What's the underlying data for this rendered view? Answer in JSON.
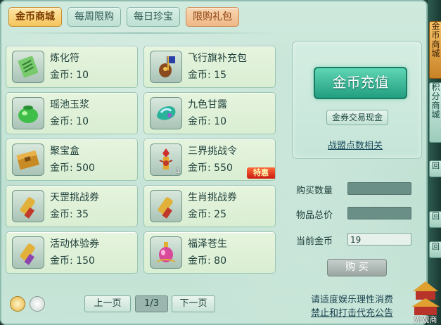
{
  "tabs": [
    {
      "label": "金币商城",
      "active": true
    },
    {
      "label": "每周限购",
      "active": false
    },
    {
      "label": "每日珍宝",
      "active": false
    },
    {
      "label": "限购礼包",
      "active": false
    }
  ],
  "currency_label": "金币:",
  "items": [
    {
      "name": "炼化符",
      "price": "10",
      "icon": "talisman-icon"
    },
    {
      "name": "飞行旗补充包",
      "price": "15",
      "icon": "flag-pack-icon"
    },
    {
      "name": "瑶池玉浆",
      "price": "10",
      "icon": "jade-jar-icon"
    },
    {
      "name": "九色甘露",
      "price": "10",
      "icon": "dew-gem-icon"
    },
    {
      "name": "聚宝盒",
      "price": "500",
      "icon": "treasure-box-icon"
    },
    {
      "name": "三界挑战令",
      "price": "550",
      "icon": "challenge-token-icon",
      "qty": "1",
      "badge": "特惠"
    },
    {
      "name": "天罡挑战券",
      "price": "35",
      "icon": "scroll-icon"
    },
    {
      "name": "生肖挑战券",
      "price": "25",
      "icon": "scroll-icon"
    },
    {
      "name": "活动体验券",
      "price": "150",
      "icon": "scroll-icon"
    },
    {
      "name": "福泽苍生",
      "price": "80",
      "icon": "potion-bottle-icon"
    }
  ],
  "right_panel": {
    "recharge_label": "金币充值",
    "exchange_label": "金券交易现金",
    "league_link": "战盟点数相关"
  },
  "purchase": {
    "quantity_label": "购买数量",
    "quantity_value": "",
    "total_label": "物品总价",
    "total_value": "",
    "current_label": "当前金币",
    "current_value": "19",
    "buy_label": "购 买"
  },
  "pagination": {
    "prev": "上一页",
    "page": "1/3",
    "next": "下一页"
  },
  "notice": [
    "请适度娱乐理性消费",
    "禁止和打击代充公告"
  ],
  "side_tabs": {
    "gold_shop": "金币商城",
    "points_shop": "积分商城",
    "small": [
      "回",
      "回",
      "回"
    ],
    "outfit": "外观商"
  },
  "colors": {
    "accent": "#229e80",
    "tab_active": "#f5c55b",
    "badge": "#c91d12"
  }
}
